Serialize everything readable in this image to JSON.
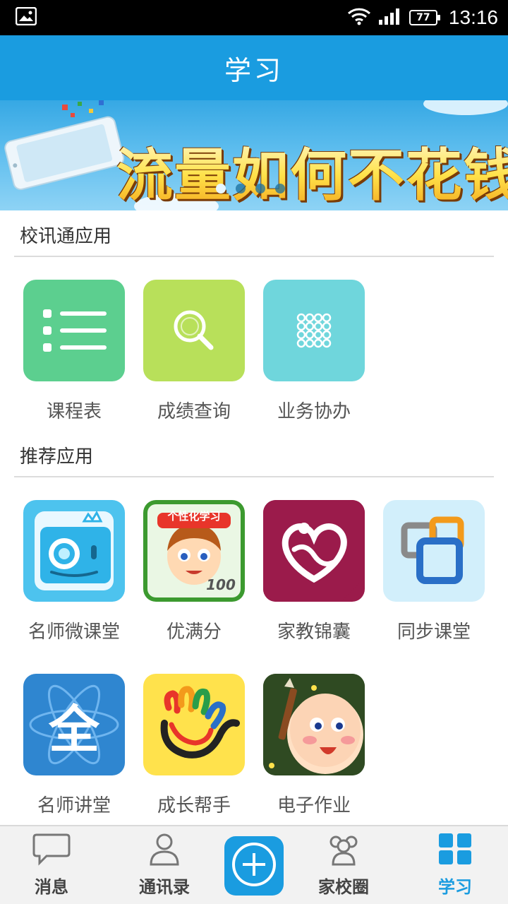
{
  "status_bar": {
    "time": "13:16",
    "battery": "77"
  },
  "title": "学习",
  "banner": {
    "text": "流量如何不花钱",
    "dot_count": 4,
    "active_dot": 0
  },
  "sections": [
    {
      "title": "校讯通应用",
      "apps": [
        {
          "label": "课程表",
          "icon": "list-icon",
          "color": "#5ccf8f"
        },
        {
          "label": "成绩查询",
          "icon": "magnifier-icon",
          "color": "#b8e05a"
        },
        {
          "label": "业务协办",
          "icon": "grid-dots-icon",
          "color": "#6fd6dc"
        }
      ]
    },
    {
      "title": "推荐应用",
      "apps": [
        {
          "label": "名师微课堂",
          "icon": "camera-mascot-icon",
          "color": "#4dc3ee"
        },
        {
          "label": "优满分",
          "icon": "boy-cartoon-icon",
          "color": "#3c9a2f",
          "badge_text": "个性化学习",
          "badge_number": "100"
        },
        {
          "label": "家教锦囊",
          "icon": "heart-logo-icon",
          "color": "#9b1b4b"
        },
        {
          "label": "同步课堂",
          "icon": "overlapping-squares-icon",
          "color": "#d2effb"
        },
        {
          "label": "名师讲堂",
          "icon": "quan-logo-icon",
          "color": "#2f86d0",
          "badge_text": "全"
        },
        {
          "label": "成长帮手",
          "icon": "colorful-hand-icon",
          "color": "#ffe24c"
        },
        {
          "label": "电子作业",
          "icon": "baby-pencil-icon",
          "color": "#3a5a2a"
        }
      ]
    }
  ],
  "tabs": [
    {
      "label": "消息",
      "icon": "chat-bubble-icon"
    },
    {
      "label": "通讯录",
      "icon": "contact-person-icon"
    },
    {
      "label": "",
      "icon": "plus-circle-icon"
    },
    {
      "label": "家校圈",
      "icon": "group-people-icon"
    },
    {
      "label": "学习",
      "icon": "four-squares-icon",
      "active": true
    }
  ],
  "colors": {
    "accent": "#1a9ce0",
    "status_bar": "#000000"
  }
}
